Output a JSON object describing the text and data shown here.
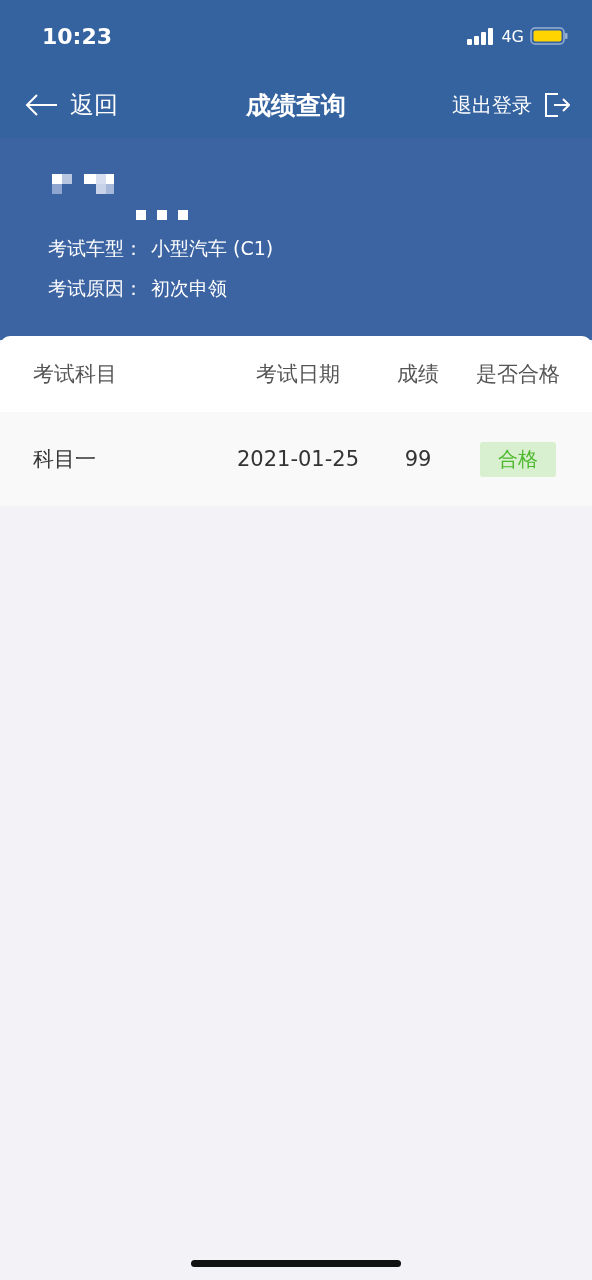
{
  "status_bar": {
    "time": "10:23",
    "network": "4G"
  },
  "nav": {
    "back": "返回",
    "title": "成绩查询",
    "logout": "退出登录"
  },
  "info": [
    {
      "label": "考试车型：",
      "value": "小型汽车 (C1)"
    },
    {
      "label": "考试原因：",
      "value": "初次申领"
    }
  ],
  "table": {
    "columns": [
      "考试科目",
      "考试日期",
      "成绩",
      "是否合格"
    ],
    "rows": [
      {
        "subject": "科目一",
        "date": "2021-01-25",
        "score": "99",
        "result": "合格",
        "passed": true
      }
    ]
  }
}
